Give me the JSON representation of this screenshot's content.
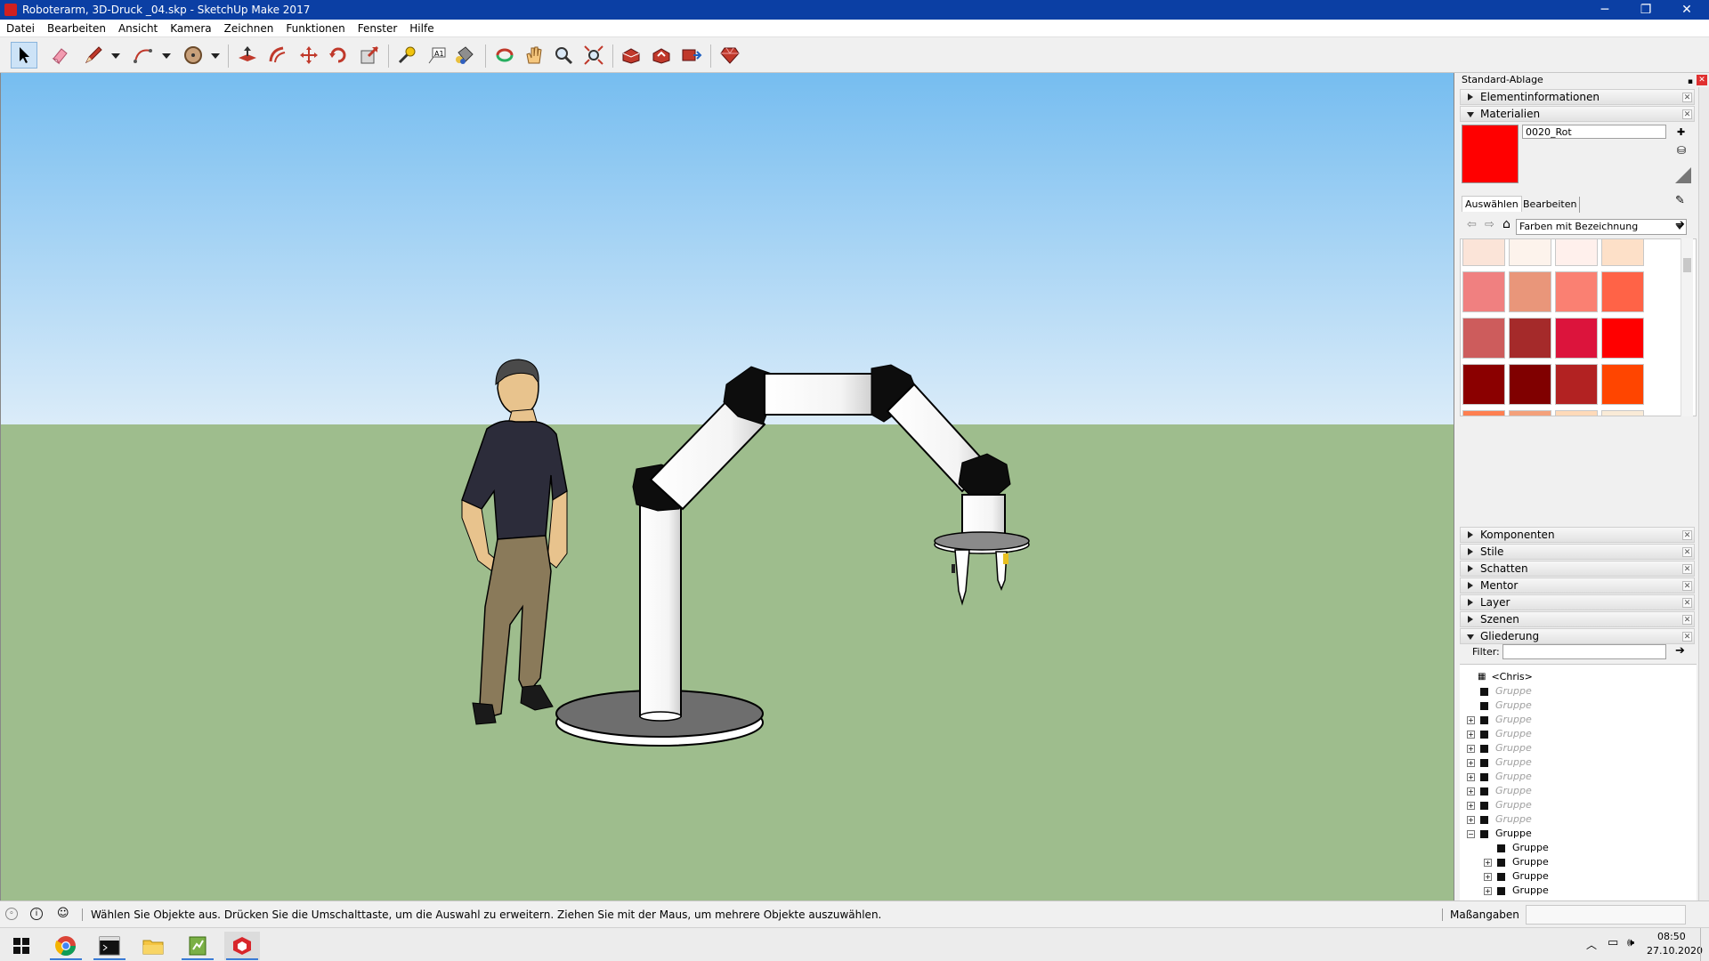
{
  "window": {
    "title": "Roboterarm, 3D-Druck _04.skp - SketchUp Make 2017",
    "minimize": "─",
    "maximize": "❐",
    "close": "✕"
  },
  "menu": [
    "Datei",
    "Bearbeiten",
    "Ansicht",
    "Kamera",
    "Zeichnen",
    "Funktionen",
    "Fenster",
    "Hilfe"
  ],
  "toolbar": [
    {
      "name": "select-tool",
      "icon": "arrow-icon"
    },
    {
      "name": "eraser-tool",
      "icon": "eraser-icon"
    },
    {
      "name": "line-tool",
      "icon": "pencil-icon"
    },
    {
      "name": "arc-tool",
      "icon": "arc-icon"
    },
    {
      "name": "shape-tool",
      "icon": "circle-icon"
    },
    {
      "name": "push-pull-tool",
      "icon": "push-pull-icon"
    },
    {
      "name": "offset-tool",
      "icon": "offset-icon"
    },
    {
      "name": "move-tool",
      "icon": "move-icon"
    },
    {
      "name": "rotate-tool",
      "icon": "rotate-icon"
    },
    {
      "name": "scale-tool",
      "icon": "scale-icon"
    },
    {
      "name": "tape-measure-tool",
      "icon": "tape-icon"
    },
    {
      "name": "text-tool",
      "icon": "text-icon"
    },
    {
      "name": "paint-bucket-tool",
      "icon": "paint-bucket-icon"
    },
    {
      "name": "orbit-tool",
      "icon": "orbit-icon"
    },
    {
      "name": "pan-tool",
      "icon": "hand-icon"
    },
    {
      "name": "zoom-tool",
      "icon": "magnifier-icon"
    },
    {
      "name": "zoom-extents-tool",
      "icon": "zoom-extents-icon"
    },
    {
      "name": "warehouse-button",
      "icon": "warehouse-icon"
    },
    {
      "name": "share-model-button",
      "icon": "share-icon"
    },
    {
      "name": "extension-warehouse-button",
      "icon": "extension-icon"
    },
    {
      "name": "ruby-console-button",
      "icon": "ruby-icon"
    }
  ],
  "tray": {
    "title": "Standard-Ablage",
    "sections_top": [
      {
        "label": "Elementinformationen",
        "open": false
      },
      {
        "label": "Materialien",
        "open": true
      }
    ],
    "materials": {
      "current_name": "0020_Rot",
      "current_color": "#ff0000",
      "tab_select": "Auswählen",
      "tab_edit": "Bearbeiten",
      "library": "Farben mit Bezeichnung",
      "swatches": [
        [
          "#fbe4d8",
          "#fdf3ec",
          "#fff0ec",
          "#fde0c8"
        ],
        [
          "#f08080",
          "#e9967a",
          "#fa8072",
          "#ff6347"
        ],
        [
          "#cd5c5c",
          "#a52a2a",
          "#dc143c",
          "#ff0000"
        ],
        [
          "#8b0000",
          "#800000",
          "#b22222",
          "#ff4500"
        ],
        [
          "#ff7f50",
          "#f4a07a",
          "#ffdab9",
          "#faebd7"
        ],
        [
          "#ffebcd",
          "#fdf5e6",
          "#fff0db",
          "#ffdead"
        ],
        [
          "#fcd9b0",
          "#f9dfc0",
          "#d2b48c",
          "#deb887"
        ]
      ]
    },
    "sections_bottom": [
      {
        "label": "Komponenten",
        "open": false
      },
      {
        "label": "Stile",
        "open": false
      },
      {
        "label": "Schatten",
        "open": false
      },
      {
        "label": "Mentor",
        "open": false
      },
      {
        "label": "Layer",
        "open": false
      },
      {
        "label": "Szenen",
        "open": false
      },
      {
        "label": "Gliederung",
        "open": true
      }
    ],
    "outliner": {
      "filter_label": "Filter:",
      "filter_value": "",
      "root": "<Chris>",
      "items": [
        {
          "label": "Gruppe",
          "indent": 1,
          "expand": "",
          "dim": true
        },
        {
          "label": "Gruppe",
          "indent": 1,
          "expand": "",
          "dim": true
        },
        {
          "label": "Gruppe",
          "indent": 1,
          "expand": "+",
          "dim": true
        },
        {
          "label": "Gruppe",
          "indent": 1,
          "expand": "+",
          "dim": true
        },
        {
          "label": "Gruppe",
          "indent": 1,
          "expand": "+",
          "dim": true
        },
        {
          "label": "Gruppe",
          "indent": 1,
          "expand": "+",
          "dim": true
        },
        {
          "label": "Gruppe",
          "indent": 1,
          "expand": "+",
          "dim": true
        },
        {
          "label": "Gruppe",
          "indent": 1,
          "expand": "+",
          "dim": true
        },
        {
          "label": "Gruppe",
          "indent": 1,
          "expand": "+",
          "dim": true
        },
        {
          "label": "Gruppe",
          "indent": 1,
          "expand": "+",
          "dim": true
        },
        {
          "label": "Gruppe",
          "indent": 1,
          "expand": "−",
          "dim": false
        },
        {
          "label": "Gruppe",
          "indent": 2,
          "expand": "",
          "dim": false
        },
        {
          "label": "Gruppe",
          "indent": 2,
          "expand": "+",
          "dim": false
        },
        {
          "label": "Gruppe",
          "indent": 2,
          "expand": "+",
          "dim": false
        },
        {
          "label": "Gruppe",
          "indent": 2,
          "expand": "+",
          "dim": false
        }
      ]
    }
  },
  "statusbar": {
    "message": "Wählen Sie Objekte aus. Drücken Sie die Umschalttaste, um die Auswahl zu erweitern. Ziehen Sie mit der Maus, um mehrere Objekte auszuwählen.",
    "measurements_label": "Maßangaben",
    "measurements_value": ""
  },
  "taskbar": {
    "apps": [
      {
        "name": "start-button",
        "icon": "windows-icon"
      },
      {
        "name": "chrome-app",
        "icon": "chrome-icon"
      },
      {
        "name": "terminal-app",
        "icon": "terminal-icon"
      },
      {
        "name": "explorer-app",
        "icon": "folder-icon"
      },
      {
        "name": "notepad-app",
        "icon": "notepad-icon"
      },
      {
        "name": "sketchup-app",
        "icon": "sketchup-icon"
      }
    ],
    "time": "08:50",
    "date": "27.10.2020"
  }
}
